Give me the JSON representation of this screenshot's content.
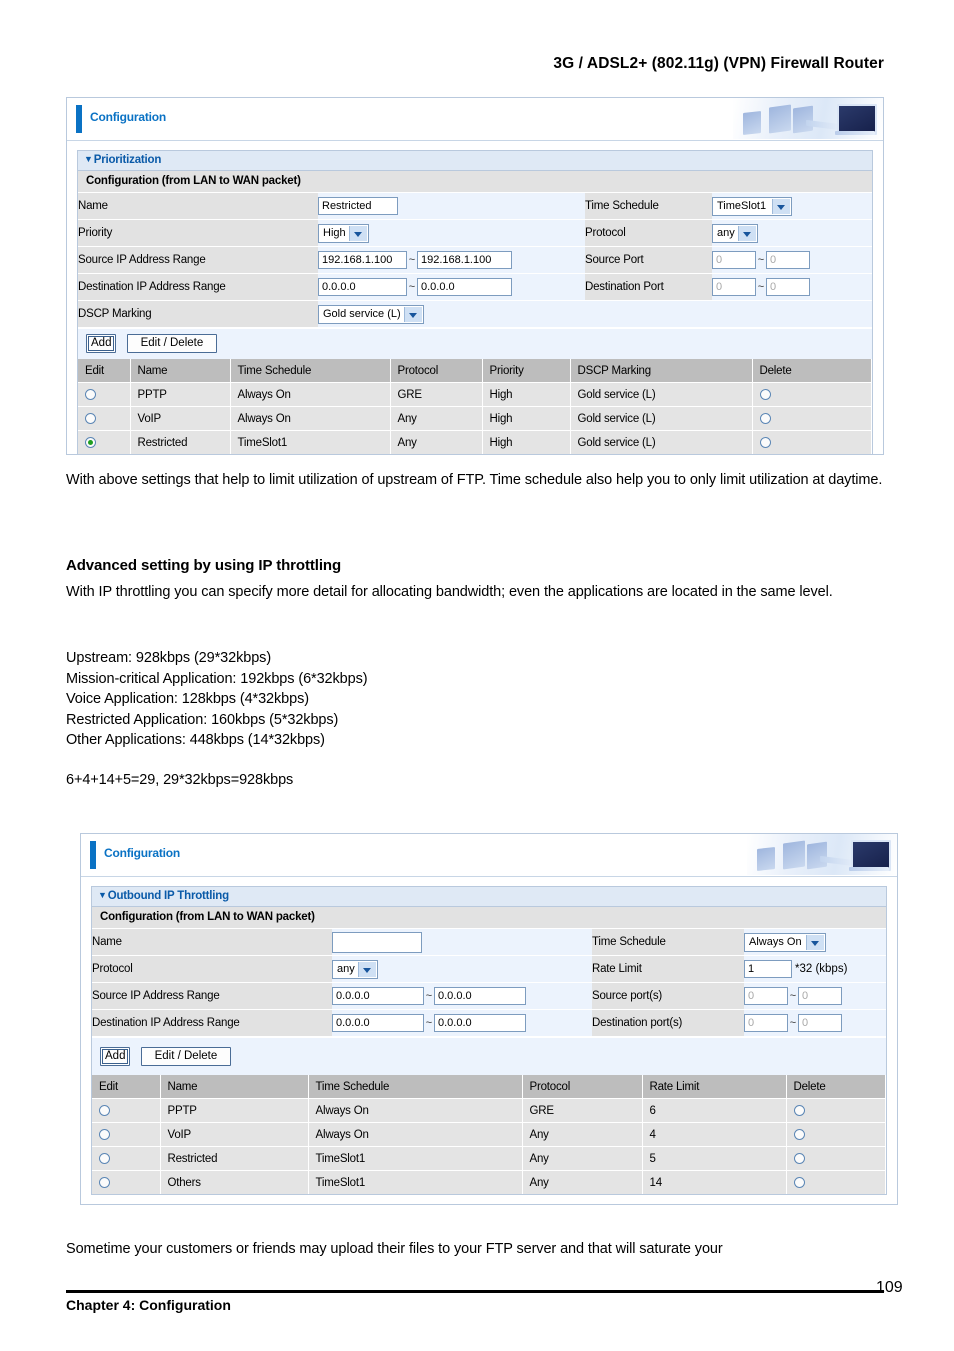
{
  "running_head": "3G / ADSL2+ (802.11g) (VPN) Firewall Router",
  "panel1": {
    "header_title": "Configuration",
    "section_title": "Prioritization",
    "subhead": "Configuration (from LAN to WAN packet)",
    "fields": {
      "name_label": "Name",
      "name_value": "Restricted",
      "time_schedule_label": "Time Schedule",
      "time_schedule_value": "TimeSlot1",
      "priority_label": "Priority",
      "priority_value": "High",
      "protocol_label": "Protocol",
      "protocol_value": "any",
      "source_ip_label": "Source IP Address Range",
      "source_ip_from": "192.168.1.100",
      "source_ip_to": "192.168.1.100",
      "source_port_label": "Source Port",
      "source_port_from": "0",
      "source_port_to": "0",
      "dest_ip_label": "Destination IP Address Range",
      "dest_ip_from": "0.0.0.0",
      "dest_ip_to": "0.0.0.0",
      "dest_port_label": "Destination Port",
      "dest_port_from": "0",
      "dest_port_to": "0",
      "dscp_label": "DSCP Marking",
      "dscp_value": "Gold service (L)",
      "range_separator": "~"
    },
    "buttons": {
      "add": "Add",
      "edit_delete": "Edit / Delete"
    },
    "table": {
      "headers": [
        "Edit",
        "Name",
        "Time Schedule",
        "Protocol",
        "Priority",
        "DSCP Marking",
        "Delete"
      ],
      "rows": [
        {
          "edit_selected": false,
          "name": "PPTP",
          "time_schedule": "Always On",
          "protocol": "GRE",
          "priority": "High",
          "dscp": "Gold service (L)",
          "delete_selected": false
        },
        {
          "edit_selected": false,
          "name": "VoIP",
          "time_schedule": "Always On",
          "protocol": "Any",
          "priority": "High",
          "dscp": "Gold service (L)",
          "delete_selected": false
        },
        {
          "edit_selected": true,
          "name": "Restricted",
          "time_schedule": "TimeSlot1",
          "protocol": "Any",
          "priority": "High",
          "dscp": "Gold service (L)",
          "delete_selected": false
        }
      ]
    }
  },
  "prose": {
    "para1": "With above settings that help to limit utilization of upstream of FTP. Time schedule also help you to only limit utilization at daytime.",
    "heading1": "Advanced setting by using IP throttling",
    "para2": "With IP throttling you can specify more detail for allocating bandwidth; even the applications are located in the same level.",
    "bandwidth_lines": [
      "Upstream: 928kbps (29*32kbps)",
      "Mission-critical Application: 192kbps (6*32kbps)",
      "Voice Application: 128kbps (4*32kbps)",
      "Restricted Application: 160kbps (5*32kbps)",
      "Other Applications: 448kbps (14*32kbps)"
    ],
    "sum_line": "6+4+14+5=29, 29*32kbps=928kbps",
    "para3": "Sometime your customers or friends may upload their files to your FTP server and that will saturate your"
  },
  "panel2": {
    "header_title": "Configuration",
    "section_title": "Outbound IP Throttling",
    "subhead": "Configuration (from LAN to WAN packet)",
    "fields": {
      "name_label": "Name",
      "name_value": "",
      "time_schedule_label": "Time Schedule",
      "time_schedule_value": "Always On",
      "protocol_label": "Protocol",
      "protocol_value": "any",
      "rate_limit_label": "Rate Limit",
      "rate_limit_value": "1",
      "rate_limit_suffix": "*32 (kbps)",
      "source_ip_label": "Source IP Address Range",
      "source_ip_from": "0.0.0.0",
      "source_ip_to": "0.0.0.0",
      "source_ports_label": "Source port(s)",
      "source_port_from": "0",
      "source_port_to": "0",
      "dest_ip_label": "Destination IP Address Range",
      "dest_ip_from": "0.0.0.0",
      "dest_ip_to": "0.0.0.0",
      "dest_ports_label": "Destination port(s)",
      "dest_port_from": "0",
      "dest_port_to": "0",
      "range_separator": "~"
    },
    "buttons": {
      "add": "Add",
      "edit_delete": "Edit / Delete"
    },
    "table": {
      "headers": [
        "Edit",
        "Name",
        "Time Schedule",
        "Protocol",
        "Rate Limit",
        "Delete"
      ],
      "rows": [
        {
          "edit_selected": false,
          "name": "PPTP",
          "time_schedule": "Always On",
          "protocol": "GRE",
          "rate_limit": "6",
          "delete_selected": false
        },
        {
          "edit_selected": false,
          "name": "VoIP",
          "time_schedule": "Always On",
          "protocol": "Any",
          "rate_limit": "4",
          "delete_selected": false
        },
        {
          "edit_selected": false,
          "name": "Restricted",
          "time_schedule": "TimeSlot1",
          "protocol": "Any",
          "rate_limit": "5",
          "delete_selected": false
        },
        {
          "edit_selected": false,
          "name": "Others",
          "time_schedule": "TimeSlot1",
          "protocol": "Any",
          "rate_limit": "14",
          "delete_selected": false
        }
      ]
    }
  },
  "footer": {
    "chapter": "Chapter 4: Configuration",
    "page_number": "109"
  },
  "colors": {
    "accent_blue": "#0a72c4",
    "section_title_blue": "#0a5aa8",
    "label_grey": "#e2e2e2",
    "field_blue": "#ecf3fd",
    "table_header_grey": "#bdbdbd",
    "table_row_grey": "#e4e4e4",
    "radio_green": "#1f9e20"
  }
}
